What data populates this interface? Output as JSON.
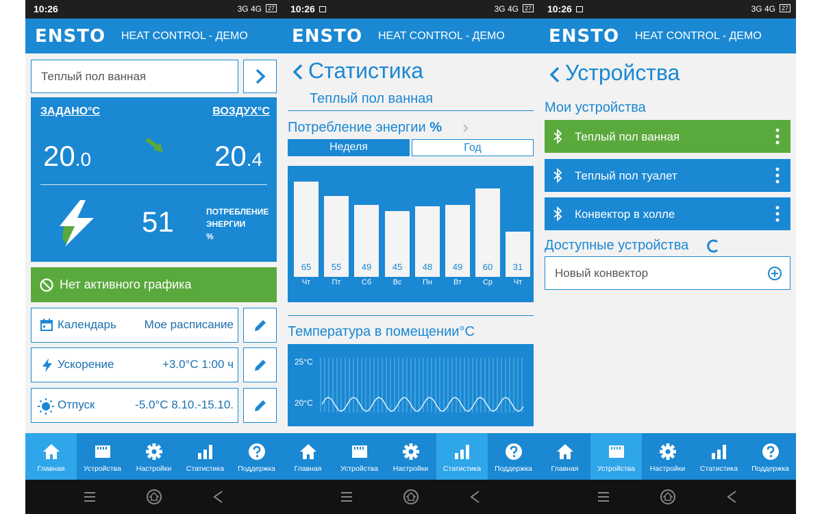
{
  "status": {
    "time": "10:26",
    "signal_text": "3G 4G",
    "battery": "27"
  },
  "app": {
    "logo": "ENSTO",
    "title": "HEAT CONTROL - ДЕМО"
  },
  "nav": [
    {
      "label": "Главная",
      "icon": "home-icon"
    },
    {
      "label": "Устройства",
      "icon": "device-icon"
    },
    {
      "label": "Настройки",
      "icon": "gear-icon"
    },
    {
      "label": "Статистика",
      "icon": "bar-chart-icon"
    },
    {
      "label": "Поддержка",
      "icon": "help-icon"
    }
  ],
  "home": {
    "device_name": "Теплый пол ванная",
    "set_label": "ЗАДАНО°C",
    "air_label": "ВОЗДУХ°C",
    "set_int": "20",
    "set_dec": ".0",
    "air_int": "20",
    "air_dec": ".4",
    "energy_value": "51",
    "energy_label_1": "ПОТРЕБЛЕНИЕ",
    "energy_label_2": "ЭНЕРГИИ",
    "energy_unit": "%",
    "no_schedule": "Нет активного графика",
    "rows": [
      {
        "label": "Календарь",
        "value": "Мое расписание"
      },
      {
        "label": "Ускорение",
        "value": "+3.0°C 1:00 ч"
      },
      {
        "label": "Отпуск",
        "value": "-5.0°C 8.10.-15.10."
      }
    ],
    "colors": {
      "primary": "#1a88d3",
      "green": "#5aa93c"
    }
  },
  "stats": {
    "title": "Статистика",
    "device_name": "Теплый пол ванная",
    "energy_title": "Потребление энергии",
    "energy_unit": "%",
    "tab_week": "Неделя",
    "tab_year": "Год",
    "temp_title": "Температура в помещении°C",
    "temp_tick_top": "25°C",
    "temp_tick_bottom": "20°C"
  },
  "chart_data": {
    "type": "bar",
    "categories": [
      "Чт",
      "Пт",
      "Сб",
      "Вс",
      "Пн",
      "Вт",
      "Ср",
      "Чт"
    ],
    "values": [
      65,
      55,
      49,
      45,
      48,
      49,
      60,
      31
    ],
    "ylim": [
      0,
      70
    ]
  },
  "devices": {
    "title": "Устройства",
    "my_devices_title": "Мои устройства",
    "my_devices": [
      {
        "name": "Теплый пол ванная",
        "active": true
      },
      {
        "name": "Теплый пол туалет",
        "active": false
      },
      {
        "name": "Конвектор в холле",
        "active": false
      }
    ],
    "available_title": "Доступные устройства",
    "new_device": "Новый конвектор"
  }
}
